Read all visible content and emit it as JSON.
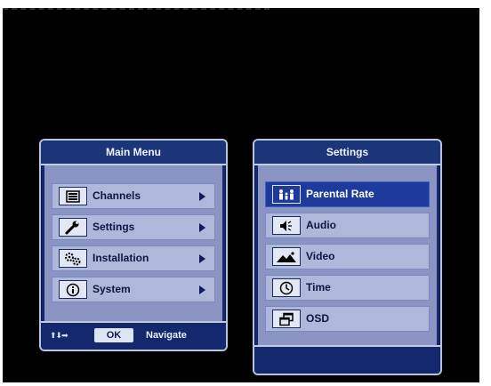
{
  "main_menu": {
    "title": "Main Menu",
    "items": [
      {
        "label": "Channels",
        "icon": "list-icon"
      },
      {
        "label": "Settings",
        "icon": "wrench-icon"
      },
      {
        "label": "Installation",
        "icon": "gears-icon"
      },
      {
        "label": "System",
        "icon": "info-icon"
      }
    ],
    "footer": {
      "arrows": "⬆⬇➡",
      "ok_label": "OK",
      "navigate_label": "Navigate"
    }
  },
  "settings_menu": {
    "title": "Settings",
    "selected_index": 0,
    "items": [
      {
        "label": "Parental Rate",
        "icon": "parental-icon"
      },
      {
        "label": "Audio",
        "icon": "speaker-icon"
      },
      {
        "label": "Video",
        "icon": "picture-icon"
      },
      {
        "label": "Time",
        "icon": "clock-icon"
      },
      {
        "label": "OSD",
        "icon": "windows-icon"
      }
    ]
  },
  "colors": {
    "panel": "#13286d",
    "item": "#aeb8db",
    "selected": "#1e3b9b",
    "border": "#b9c3de"
  }
}
